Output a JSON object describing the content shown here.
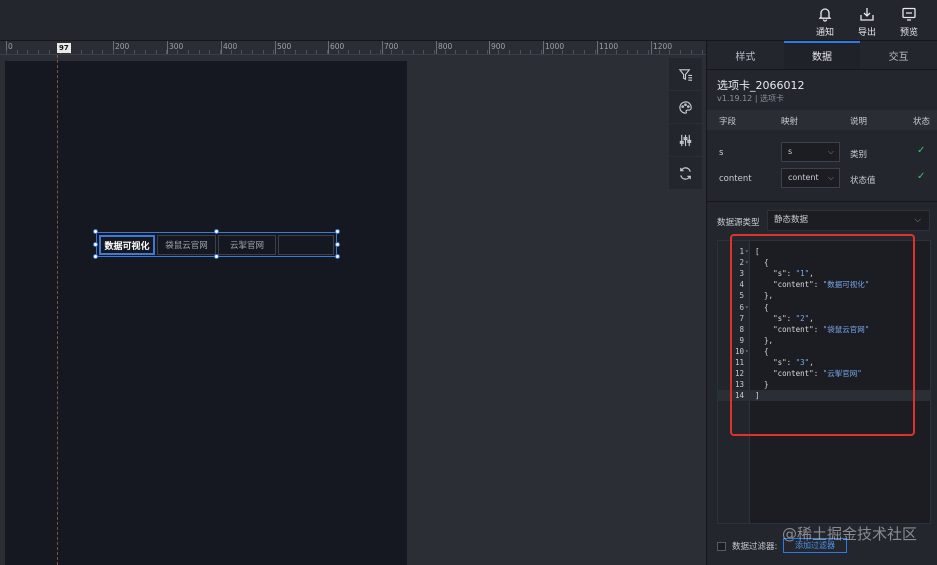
{
  "topbar": {
    "actions": [
      {
        "label": "通知",
        "icon": "bell-icon"
      },
      {
        "label": "导出",
        "icon": "export-icon"
      },
      {
        "label": "预览",
        "icon": "preview-icon"
      }
    ]
  },
  "ruler": {
    "marker": "97",
    "labels": [
      "0",
      "200",
      "300",
      "400",
      "500",
      "600",
      "700",
      "800",
      "900",
      "1000",
      "1100",
      "1200"
    ]
  },
  "canvas": {
    "tabs": [
      {
        "label": "数据可视化",
        "active": true
      },
      {
        "label": "袋鼠云官网",
        "active": false
      },
      {
        "label": "云掣官网",
        "active": false
      },
      {
        "label": "",
        "active": false
      }
    ]
  },
  "floating_tools": [
    "filter-icon",
    "palette-icon",
    "sliders-icon",
    "refresh-icon"
  ],
  "panel": {
    "tabs": [
      {
        "label": "样式",
        "active": false
      },
      {
        "label": "数据",
        "active": true
      },
      {
        "label": "交互",
        "active": false
      }
    ],
    "component_title": "选项卡_2066012",
    "component_sub": "v1.19.12 | 选项卡",
    "field_headers": {
      "field": "字段",
      "mapping": "映射",
      "desc": "说明",
      "status": "状态"
    },
    "fields": [
      {
        "name": "s",
        "mapping": "s",
        "desc": "类别",
        "status": "✓"
      },
      {
        "name": "content",
        "mapping": "content",
        "desc": "状态值",
        "status": "✓"
      }
    ],
    "source_label": "数据源类型",
    "source_value": "静态数据",
    "code_lines": [
      {
        "n": "1",
        "fold": true,
        "indent": 0,
        "text": "["
      },
      {
        "n": "2",
        "fold": true,
        "indent": 1,
        "text": "{"
      },
      {
        "n": "3",
        "fold": false,
        "indent": 2,
        "key": "\"s\"",
        "value": "\"1\"",
        "trail": ","
      },
      {
        "n": "4",
        "fold": false,
        "indent": 2,
        "key": "\"content\"",
        "value": "\"数据可视化\"",
        "trail": ""
      },
      {
        "n": "5",
        "fold": false,
        "indent": 1,
        "text": "},"
      },
      {
        "n": "6",
        "fold": true,
        "indent": 1,
        "text": "{"
      },
      {
        "n": "7",
        "fold": false,
        "indent": 2,
        "key": "\"s\"",
        "value": "\"2\"",
        "trail": ","
      },
      {
        "n": "8",
        "fold": false,
        "indent": 2,
        "key": "\"content\"",
        "value": "\"袋鼠云官网\"",
        "trail": ""
      },
      {
        "n": "9",
        "fold": false,
        "indent": 1,
        "text": "},"
      },
      {
        "n": "10",
        "fold": true,
        "indent": 1,
        "text": "{"
      },
      {
        "n": "11",
        "fold": false,
        "indent": 2,
        "key": "\"s\"",
        "value": "\"3\"",
        "trail": ","
      },
      {
        "n": "12",
        "fold": false,
        "indent": 2,
        "key": "\"content\"",
        "value": "\"云掣官网\"",
        "trail": ""
      },
      {
        "n": "13",
        "fold": false,
        "indent": 1,
        "text": "}"
      },
      {
        "n": "14",
        "fold": false,
        "indent": 0,
        "text": "]",
        "current": true
      }
    ],
    "filter_label": "数据过滤器:",
    "add_filter_label": "添加过滤器"
  },
  "watermark": "@稀土掘金技术社区",
  "colors": {
    "accent": "#2c7be5",
    "highlight": "#e0322a",
    "ok": "#3fbf6f"
  }
}
